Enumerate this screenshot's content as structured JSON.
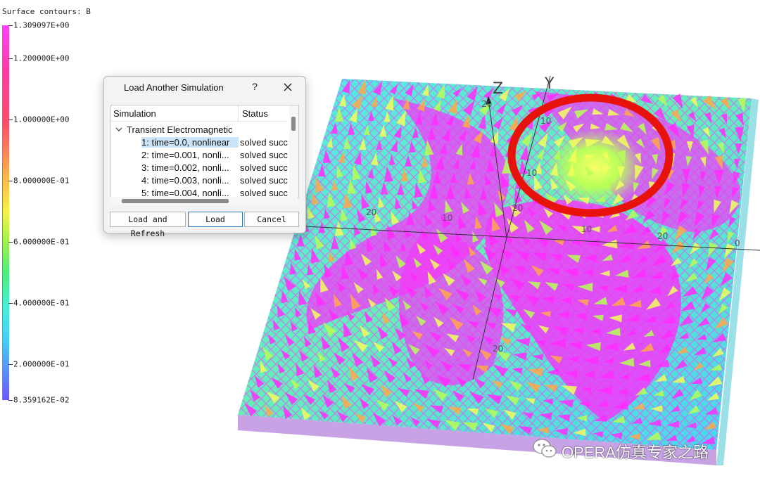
{
  "legend": {
    "title": "Surface contours: B",
    "ticks": [
      {
        "value": 1.309097,
        "label": "1.309097E+00"
      },
      {
        "value": 1.2,
        "label": "1.200000E+00"
      },
      {
        "value": 1.0,
        "label": "1.000000E+00"
      },
      {
        "value": 0.8,
        "label": "8.000000E-01"
      },
      {
        "value": 0.6,
        "label": "6.000000E-01"
      },
      {
        "value": 0.4,
        "label": "4.000000E-01"
      },
      {
        "value": 0.2,
        "label": "2.000000E-01"
      },
      {
        "value": 0.08359162,
        "label": "8.359162E-02"
      }
    ],
    "min": 0.08359162,
    "max": 1.309097
  },
  "axes": {
    "y_label": "Y",
    "z_label": "Z",
    "tick_labels": [
      "20",
      "10",
      "10",
      "20",
      "10",
      "20",
      "10",
      "20",
      "20",
      "0"
    ]
  },
  "dialog": {
    "title": "Load Another Simulation",
    "help_glyph": "?",
    "columns": [
      "Simulation",
      "Status"
    ],
    "group": "Transient Electromagnetic",
    "rows": [
      {
        "name": "1: time=0.0, nonlinear",
        "status": "solved succ",
        "selected": true
      },
      {
        "name": "2: time=0.001, nonli...",
        "status": "solved succ",
        "selected": false
      },
      {
        "name": "3: time=0.002, nonli...",
        "status": "solved succ",
        "selected": false
      },
      {
        "name": "4: time=0.003, nonli...",
        "status": "solved succ",
        "selected": false
      },
      {
        "name": "5: time=0.004, nonli...",
        "status": "solved succ",
        "selected": false
      }
    ],
    "buttons": {
      "load_refresh": "Load and Refresh",
      "load": "Load",
      "cancel": "Cancel"
    }
  },
  "watermark": {
    "text": "OPERA仿真专家之路"
  },
  "colors": {
    "highlight_ring": "#e8120c",
    "field_high": "#ff2bff",
    "field_low": "#39c8ff",
    "selection": "#cce4f7",
    "accent": "#2c78c8"
  }
}
